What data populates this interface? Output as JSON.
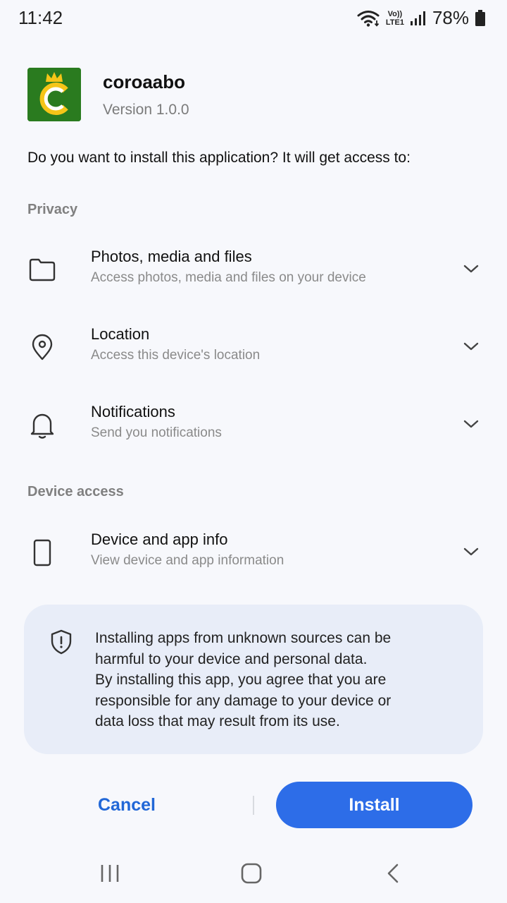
{
  "status_bar": {
    "time": "11:42",
    "battery": "78%",
    "network_vo": "Vo))",
    "network_lte": "LTE1"
  },
  "app": {
    "name": "coroaabo",
    "version": "Version 1.0.0",
    "icon_letter": "C",
    "icon_bg": "#2a7b1f",
    "icon_accent": "#f5c518"
  },
  "prompt": "Do you want to install this application? It will get access to:",
  "sections": {
    "privacy": "Privacy",
    "device_access": "Device access"
  },
  "permissions": [
    {
      "title": "Photos, media and files",
      "desc": "Access photos, media and files on your device",
      "icon": "folder-icon"
    },
    {
      "title": "Location",
      "desc": "Access this device's location",
      "icon": "location-pin-icon"
    },
    {
      "title": "Notifications",
      "desc": "Send you notifications",
      "icon": "bell-icon"
    },
    {
      "title": "Device and app info",
      "desc": "View device and app information",
      "icon": "phone-icon"
    }
  ],
  "warning": {
    "lines": [
      "Installing apps from unknown sources can be",
      "harmful to your device and personal data.",
      "By installing this app, you agree that you are",
      "responsible for any damage to your device or",
      "data loss that may result from its use."
    ],
    "icon": "shield-icon"
  },
  "actions": {
    "cancel": "Cancel",
    "install": "Install"
  },
  "colors": {
    "accent": "#2d6de8",
    "cancel_text": "#2167d7",
    "card_bg": "#e8edf8",
    "background": "#f7f8fc"
  }
}
